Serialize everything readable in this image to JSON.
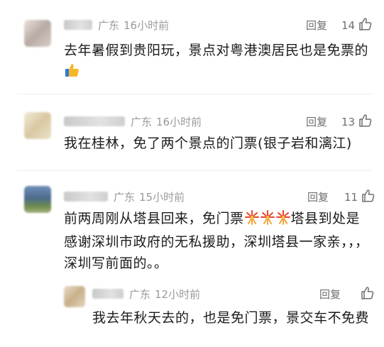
{
  "comments": [
    {
      "location": "广东",
      "time": "16小时前",
      "reply_label": "回复",
      "likes": "14",
      "text": "去年暑假到贵阳玩，景点对粤港澳居民也是免票的",
      "emoji": "thumbs-up-icon"
    },
    {
      "location": "广东",
      "time": "16小时前",
      "reply_label": "回复",
      "likes": "13",
      "text": "我在桂林，免了两个景点的门票(银子岩和漓江)"
    },
    {
      "location": "广东",
      "time": "15小时前",
      "reply_label": "回复",
      "likes": "11",
      "text_part1": "前两周刚从塔县回来，免门票",
      "text_part2": "塔县到处是感谢深圳市政府的无私援助，深圳塔县一家亲，，，深圳写前面的。。",
      "emoji": "fireworks-icon"
    }
  ],
  "reply": {
    "location": "广东",
    "time": "12小时前",
    "reply_label": "回复",
    "text": "我去年秋天去的，也是免门票，景交车不免费"
  },
  "colors": {
    "meta": "#9a9a9a",
    "text": "#1b1b1b",
    "action": "#6f6f6f"
  }
}
